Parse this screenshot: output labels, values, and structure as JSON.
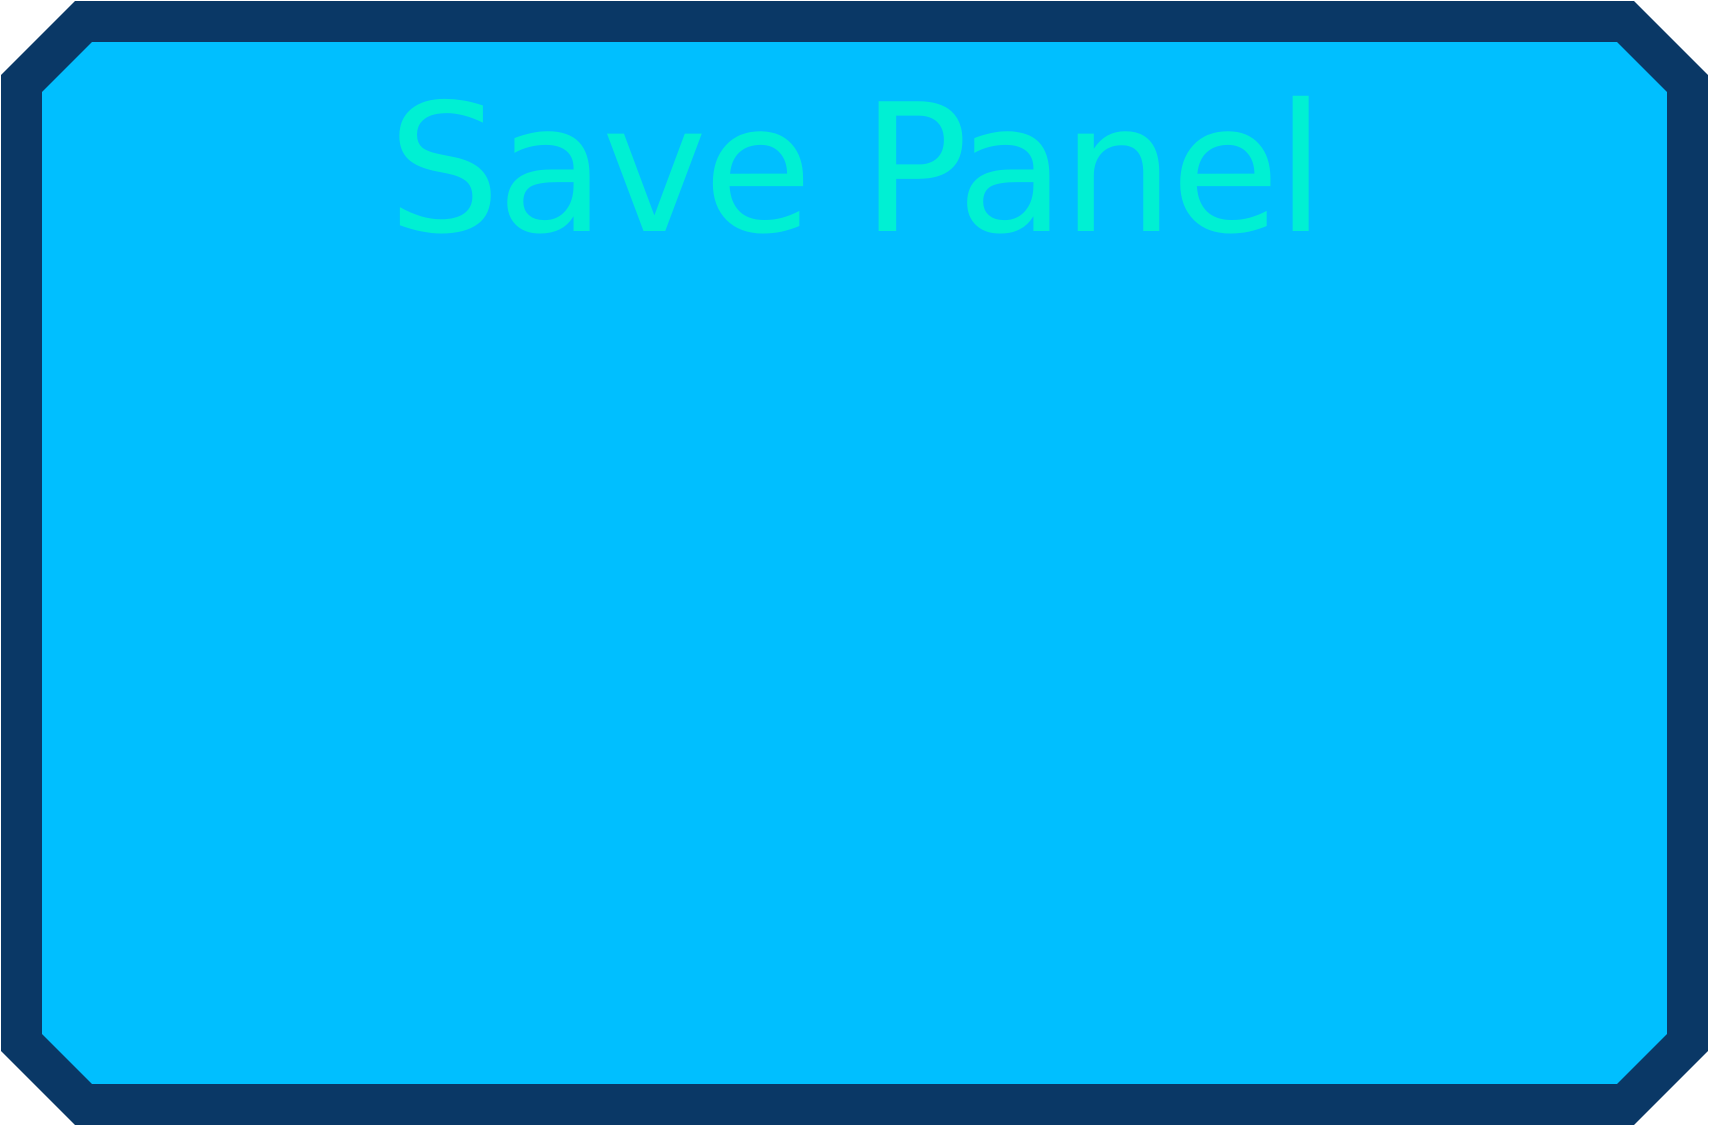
{
  "panel": {
    "title": "Save Panel",
    "colors": {
      "border": "#0a3866",
      "fill": "#00bfff",
      "title": "#00f0d3"
    }
  }
}
